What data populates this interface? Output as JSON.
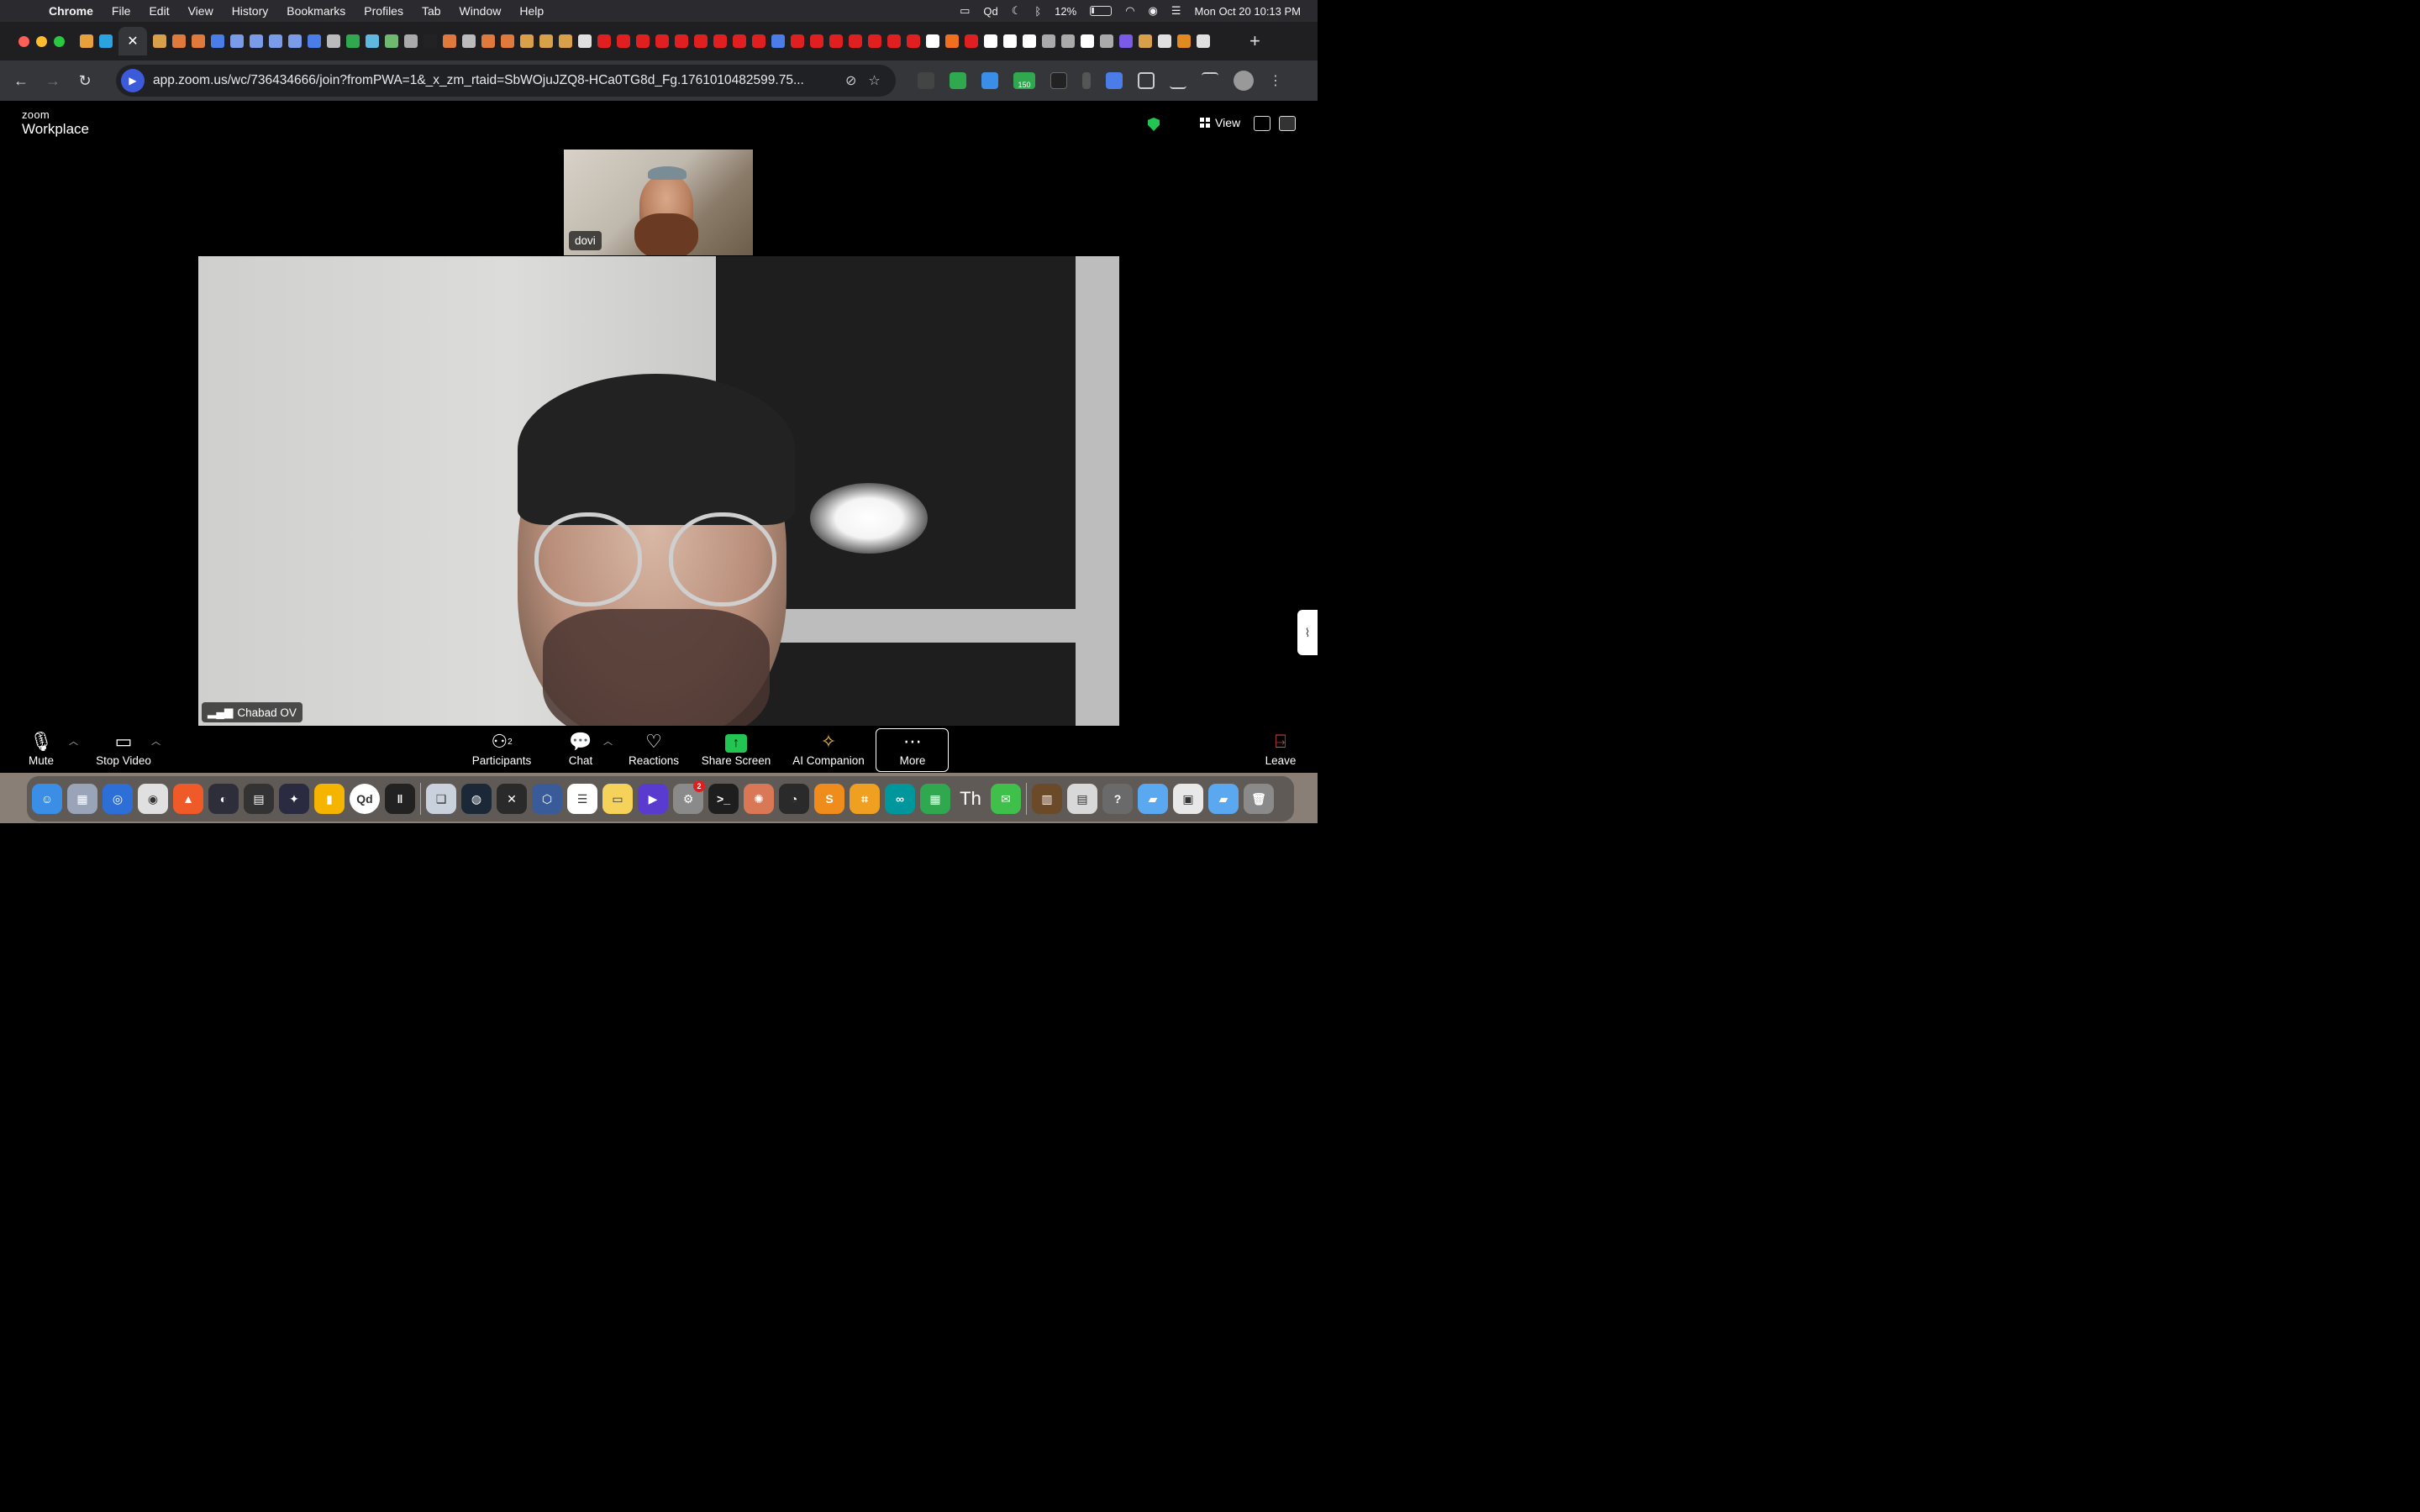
{
  "menubar": {
    "app_name": "Chrome",
    "items": [
      "File",
      "Edit",
      "View",
      "History",
      "Bookmarks",
      "Profiles",
      "Tab",
      "Window",
      "Help"
    ],
    "status_app": "Qd",
    "battery": "12%",
    "datetime": "Mon Oct 20  10:13 PM"
  },
  "browser": {
    "url": "app.zoom.us/wc/736434666/join?fromPWA=1&_x_zm_rtaid=SbWOjuJZQ8-HCa0TG8d_Fg.1761010482599.75...",
    "extension_badge": "150",
    "tab_colors": [
      "#e8a03c",
      "#2aa3e0",
      "#ffffff",
      "#d9a04a",
      "#e07a3c",
      "#e07a3c",
      "#4a7de8",
      "#7a9be8",
      "#7a9be8",
      "#7a9be8",
      "#7a9be8",
      "#4a7de8",
      "#bbbbbb",
      "#2fa84f",
      "#5fb8e0",
      "#6fb86f",
      "#aaaaaa",
      "#222222",
      "#e07a3c",
      "#bbbbbb",
      "#e07a3c",
      "#e07a3c",
      "#d9a04a",
      "#d9a04a",
      "#d9a04a",
      "#e0e0e0",
      "#e02020",
      "#e02020",
      "#e02020",
      "#e02020",
      "#e02020",
      "#e02020",
      "#e02020",
      "#e02020",
      "#e02020",
      "#4a7de8",
      "#e02020",
      "#e02020",
      "#e02020",
      "#e02020",
      "#e02020",
      "#e02020",
      "#e02020",
      "#ffffff",
      "#f07020",
      "#e02020",
      "#ffffff",
      "#ffffff",
      "#ffffff",
      "#aaaaaa",
      "#aaaaaa",
      "#ffffff",
      "#aaaaaa",
      "#7a5be8",
      "#d9a04a",
      "#e0e0e0",
      "#e08a20",
      "#e0e0e0"
    ]
  },
  "zoom": {
    "brand_small": "zoom",
    "brand_big": "Workplace",
    "view_label": "View",
    "thumbnail_name": "dovi",
    "main_name": "Chabad OV",
    "controls": {
      "mute": "Mute",
      "stop_video": "Stop Video",
      "participants": "Participants",
      "participants_count": "2",
      "chat": "Chat",
      "reactions": "Reactions",
      "share_screen": "Share Screen",
      "ai_companion": "AI Companion",
      "more": "More",
      "leave": "Leave"
    }
  },
  "dock": {
    "notification_badge": "2",
    "qd_label": "Qd",
    "th_label": "Th",
    "icons": [
      {
        "name": "finder-icon",
        "color": "#3a8ee6",
        "text": "☺"
      },
      {
        "name": "launchpad-icon",
        "color": "#9aa4b8",
        "text": "▦"
      },
      {
        "name": "safari-like-icon",
        "color": "#2d6fd6",
        "text": "◎"
      },
      {
        "name": "chrome-icon",
        "color": "#e0e0e0",
        "text": "◉"
      },
      {
        "name": "brave-icon",
        "color": "#f05a28",
        "text": "▲"
      },
      {
        "name": "obs-icon",
        "color": "#2e2e3a",
        "text": "◐"
      },
      {
        "name": "clapper-icon",
        "color": "#333333",
        "text": "▤"
      },
      {
        "name": "davinci-icon",
        "color": "#2a2a40",
        "text": "✦"
      },
      {
        "name": "keep-icon",
        "color": "#f5b400",
        "text": "▮"
      },
      {
        "name": "qd-icon",
        "color": "#ffffff",
        "text": ""
      },
      {
        "name": "meter-icon",
        "color": "#222222",
        "text": "‖"
      }
    ],
    "icons2": [
      {
        "name": "preview-icon",
        "color": "#c9d2dc",
        "text": "❏"
      },
      {
        "name": "steam-icon",
        "color": "#1b2838",
        "text": "◍"
      },
      {
        "name": "graph-icon",
        "color": "#2a2a2a",
        "text": "✕"
      },
      {
        "name": "blender-alt-icon",
        "color": "#3a5b9a",
        "text": "⬡"
      },
      {
        "name": "reminders-icon",
        "color": "#ffffff",
        "text": "☰"
      },
      {
        "name": "notes-icon",
        "color": "#f5d35a",
        "text": "▭"
      },
      {
        "name": "video-app-icon",
        "color": "#5a3bd0",
        "text": "▶"
      },
      {
        "name": "settings-icon",
        "color": "#8a8a8a",
        "text": "⚙"
      },
      {
        "name": "terminal-icon",
        "color": "#1e1e1e",
        "text": ">_"
      },
      {
        "name": "claude-icon",
        "color": "#d97757",
        "text": "✺"
      },
      {
        "name": "blender-icon",
        "color": "#2a2a2a",
        "text": "◔"
      },
      {
        "name": "sublime-icon",
        "color": "#f08c1c",
        "text": "S"
      },
      {
        "name": "crop-icon",
        "color": "#f0a020",
        "text": "⌗"
      },
      {
        "name": "arduino-icon",
        "color": "#00979c",
        "text": "∞"
      },
      {
        "name": "numbers-icon",
        "color": "#2fa84f",
        "text": "▦"
      },
      {
        "name": "th-icon",
        "color": "#555555",
        "text": ""
      },
      {
        "name": "messages-icon",
        "color": "#3fc04a",
        "text": "✉"
      }
    ],
    "icons3": [
      {
        "name": "photo-stack-icon",
        "color": "#6b4a2a",
        "text": "▥"
      },
      {
        "name": "document-icon",
        "color": "#d8d8d8",
        "text": "▤"
      },
      {
        "name": "help-icon",
        "color": "#6a6a6a",
        "text": "?"
      },
      {
        "name": "folder-icon",
        "color": "#5aa8f0",
        "text": "▰"
      },
      {
        "name": "image-file-icon",
        "color": "#e8e8e8",
        "text": "▣"
      },
      {
        "name": "folder2-icon",
        "color": "#5aa8f0",
        "text": "▰"
      },
      {
        "name": "trash-icon",
        "color": "#8a8a8a",
        "text": "🗑"
      }
    ]
  }
}
